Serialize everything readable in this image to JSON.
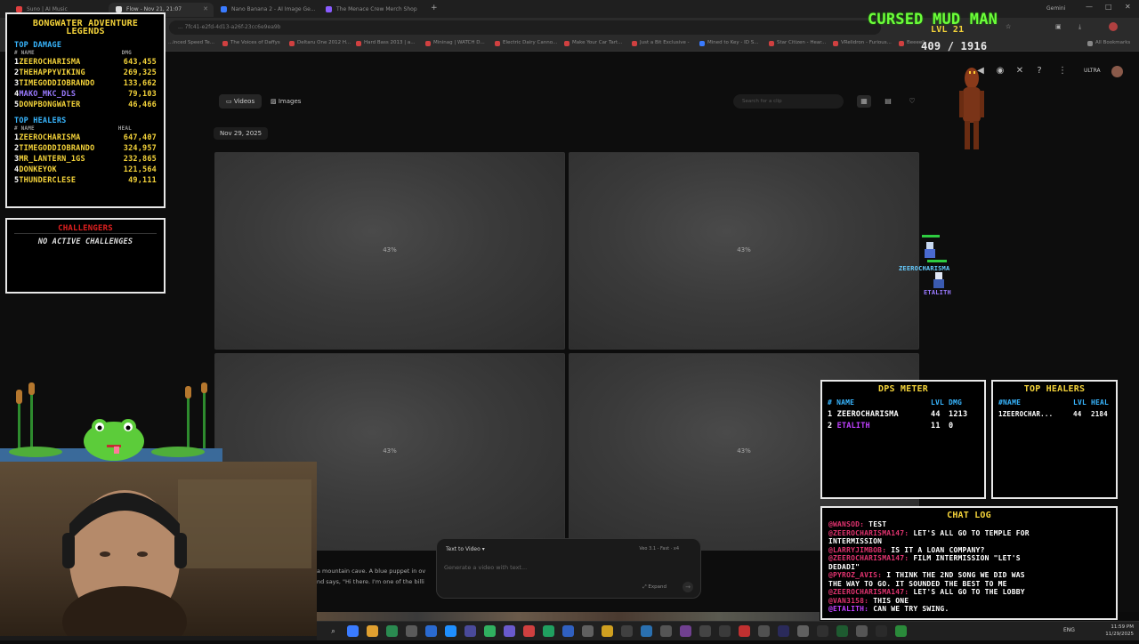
{
  "browser": {
    "tabs": [
      {
        "label": "Suno | AI Music",
        "color": "#e04040"
      },
      {
        "label": "Flow - Nov 21, 21:07",
        "color": "#ffffff"
      },
      {
        "label": "Nano Banana 2 - AI Image Ge...",
        "color": "#3a7bff"
      },
      {
        "label": "The Menace Crew Merch Shop",
        "color": "#8a5cff"
      }
    ],
    "address": "... 7fc41-e2fd-4d13-a26f-23cc6e9ea9b",
    "bookmarks": [
      "...inced Speed Te...",
      "The Voices of Daffys",
      "Deltaru One 2012 H...",
      "Hard Bass 2013 | a...",
      "Mininag | WATCH D...",
      "Electric Dairy Canno...",
      "Make Your Car Tart...",
      "Just a Bit Exclusive -",
      "Mined to Key - ID S...",
      "Star Citizen - Hear...",
      "VRelidron - Furious...",
      "Beeeeli"
    ],
    "all_bookmarks": "All Bookmarks",
    "profile": "Gemini"
  },
  "page": {
    "tabs": [
      {
        "label": "Videos",
        "icon": "video-icon"
      },
      {
        "label": "Images",
        "icon": "image-icon"
      }
    ],
    "search_placeholder": "Search for a clip",
    "date": "Nov 29, 2025",
    "cards": [
      {
        "progress": "43%"
      },
      {
        "progress": "43%"
      },
      {
        "progress": "43%"
      },
      {
        "progress": "43%"
      }
    ],
    "caption_line1": "a mountain cave. A blue puppet in ov",
    "caption_line2": "nd says, \"Hi there. I'm one of the billi",
    "prompt": {
      "mode": "Text to Video",
      "model": "Veo 3.1 - Fast",
      "count": "x4",
      "placeholder": "Generate a video with text...",
      "expand": "Expand"
    },
    "plan": "ULTRA"
  },
  "leaderboard": {
    "title1": "BONGWATER ADVENTURE",
    "title2": "LEGENDS",
    "damage_title": "TOP DAMAGE",
    "damage_hdr": {
      "name": "# NAME",
      "val": "DMG"
    },
    "damage": [
      {
        "rank": "1",
        "name": "ZEEROCHARISMA",
        "val": "643,455"
      },
      {
        "rank": "2",
        "name": "THEHAPPYVIKING",
        "val": "269,325"
      },
      {
        "rank": "3",
        "name": "TIMEGODDIOBRANDO",
        "val": "133,662"
      },
      {
        "rank": "4",
        "name": "MAKO_MKC_DLS",
        "val": "79,103"
      },
      {
        "rank": "5",
        "name": "DONPBONGWATER",
        "val": "46,466"
      }
    ],
    "healers_title": "TOP HEALERS",
    "healers_hdr": {
      "name": "# NAME",
      "val": "HEAL"
    },
    "healers": [
      {
        "rank": "1",
        "name": "ZEEROCHARISMA",
        "val": "647,407"
      },
      {
        "rank": "2",
        "name": "TIMEGODDIOBRANDO",
        "val": "324,957"
      },
      {
        "rank": "3",
        "name": "MR_LANTERN_1GS",
        "val": "232,865"
      },
      {
        "rank": "4",
        "name": "DONKEYOK",
        "val": "121,564"
      },
      {
        "rank": "5",
        "name": "THUNDERCLESE",
        "val": "49,111"
      }
    ]
  },
  "challengers": {
    "title": "CHALLENGERS",
    "empty": "NO ACTIVE CHALLENGES"
  },
  "hero": {
    "name": "CURSED MUD MAN",
    "level": "LVL 21",
    "stats": "409 / 1916"
  },
  "sprites": {
    "player1": "ZEEROCHARISMA",
    "player2": "ETALITH"
  },
  "dps_meter": {
    "title": "DPS METER",
    "hdr": {
      "num": "#",
      "name": "NAME",
      "lvl": "LVL",
      "val": "DMG"
    },
    "rows": [
      {
        "rank": "1",
        "name": "ZEEROCHARISMA",
        "lvl": "44",
        "val": "1213",
        "color": "#ffffff"
      },
      {
        "rank": "2",
        "name": "ETALITH",
        "lvl": "11",
        "val": "0",
        "color": "#c040ff"
      }
    ]
  },
  "top_healers": {
    "title": "TOP HEALERS",
    "hdr": {
      "num": "#",
      "name": "NAME",
      "lvl": "LVL",
      "val": "HEAL"
    },
    "rows": [
      {
        "rank": "1",
        "name": "ZEEROCHAR...",
        "lvl": "44",
        "val": "2184"
      }
    ]
  },
  "chat": {
    "title": "CHAT LOG",
    "lines": [
      {
        "user": "@WANSOD:",
        "text": "TEST",
        "cls": "u"
      },
      {
        "user": "@ZEEROCHARISMA147:",
        "text": "LET'S ALL GO TO TEMPLE FOR",
        "cls": "u"
      },
      {
        "user": "",
        "text": "INTERMISSION",
        "cls": "u"
      },
      {
        "user": "@LARRYJIMBOB:",
        "text": "IS IT A LOAN COMPANY?",
        "cls": "u"
      },
      {
        "user": "@ZEEROCHARISMA147:",
        "text": "FILM INTERMISSION \"LET'S",
        "cls": "u"
      },
      {
        "user": "",
        "text": "DEDADI\"",
        "cls": "u"
      },
      {
        "user": "@PYROZ_AVIS:",
        "text": "I THINK THE 2ND SONG WE DID WAS",
        "cls": "u"
      },
      {
        "user": "",
        "text": "THE WAY TO GO. IT SOUNDED THE BEST TO ME",
        "cls": "u"
      },
      {
        "user": "@ZEEROCHARISMA147:",
        "text": "LET'S ALL GO TO THE LOBBY",
        "cls": "u"
      },
      {
        "user": "@VAN3158:",
        "text": "THIS ONE",
        "cls": "u"
      },
      {
        "user": "@ETALITH:",
        "text": "CAN WE TRY SWING.",
        "cls": "u2"
      }
    ]
  },
  "taskbar": {
    "language": "ENG",
    "time": "11:59 PM",
    "date": "11/29/2025"
  }
}
